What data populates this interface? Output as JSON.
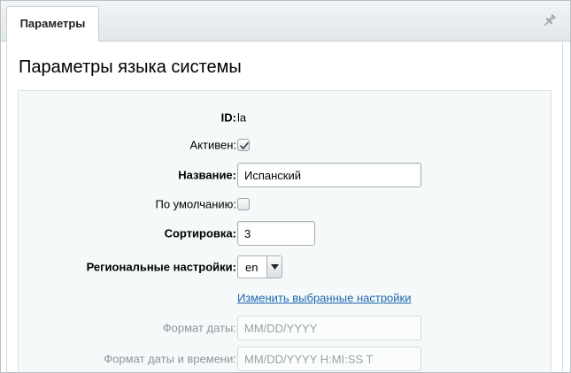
{
  "tabs": [
    {
      "label": "Параметры",
      "active": true
    }
  ],
  "header": {
    "pin_icon": "pin-icon"
  },
  "page": {
    "title": "Параметры языка системы"
  },
  "form": {
    "id": {
      "label": "ID:",
      "value": "la"
    },
    "active": {
      "label": "Активен:",
      "checked": true
    },
    "name": {
      "label": "Название:",
      "value": "Испанский"
    },
    "default": {
      "label": "По умолчанию:",
      "checked": false
    },
    "sort": {
      "label": "Сортировка:",
      "value": "3"
    },
    "regional": {
      "label": "Региональные настройки:",
      "selected": "en"
    },
    "change_link": "Изменить выбранные настройки",
    "date_format": {
      "label": "Формат даты:",
      "value": "MM/DD/YYYY"
    },
    "datetime_format": {
      "label": "Формат даты и времени:",
      "value": "MM/DD/YYYY H:MI:SS T"
    }
  },
  "colors": {
    "link": "#2067b0",
    "content_bg": "#f5f9f9",
    "dim_text": "#8d9599"
  }
}
